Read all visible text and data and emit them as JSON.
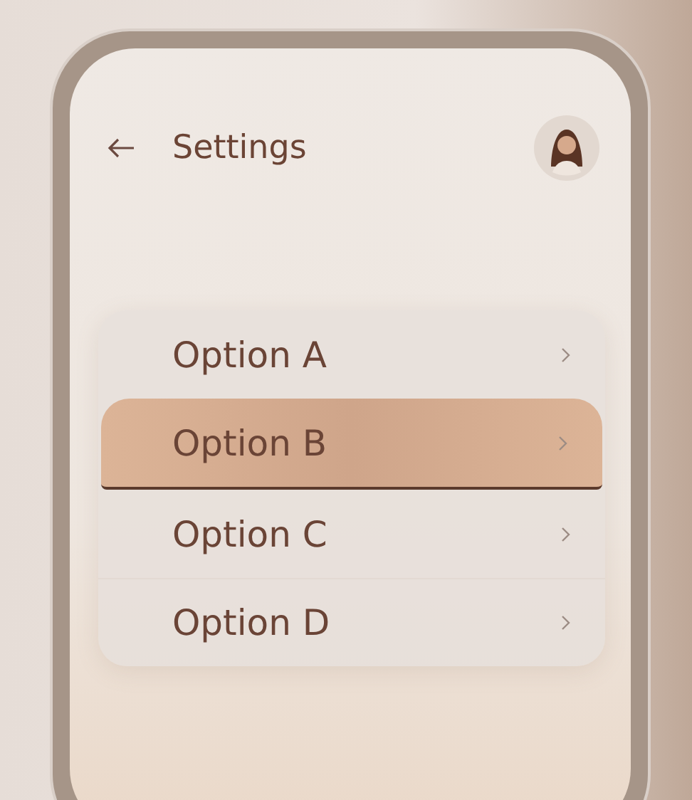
{
  "header": {
    "title": "Settings"
  },
  "options": [
    {
      "label": "Option A",
      "selected": false
    },
    {
      "label": "Option B",
      "selected": true
    },
    {
      "label": "Option C",
      "selected": false
    },
    {
      "label": "Option D",
      "selected": false
    }
  ]
}
